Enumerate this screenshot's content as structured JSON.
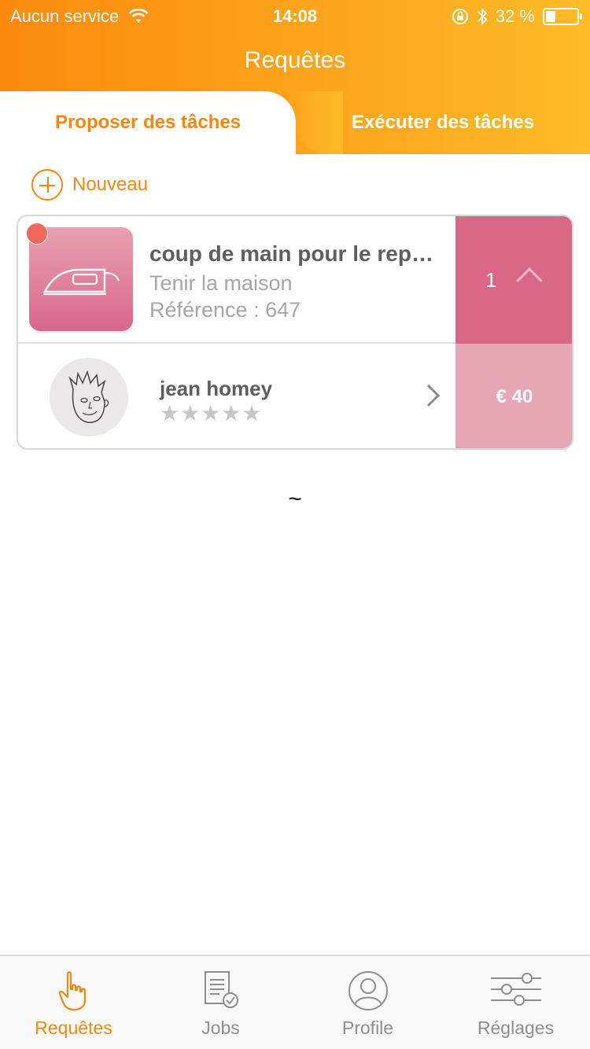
{
  "status_bar": {
    "carrier": "Aucun service",
    "time": "14:08",
    "battery_percent": "32 %",
    "battery_level": 0.32
  },
  "nav": {
    "title": "Requêtes"
  },
  "tabs": [
    {
      "label": "Proposer des tâches",
      "active": true
    },
    {
      "label": "Exécuter des tâches",
      "active": false
    }
  ],
  "new_button": {
    "label": "Nouveau"
  },
  "request_card": {
    "title": "coup de main pour le rep…",
    "category": "Tenir la maison",
    "reference": "Référence : 647",
    "count": "1",
    "user_name": "jean homey",
    "stars": "★★★★★",
    "rating": 0,
    "price": "€ 40",
    "icon": "iron-icon"
  },
  "footer_mark": "~",
  "tabbar": [
    {
      "label": "Requêtes",
      "icon": "hand-pointer-icon",
      "active": true
    },
    {
      "label": "Jobs",
      "icon": "document-check-icon",
      "active": false
    },
    {
      "label": "Profile",
      "icon": "user-icon",
      "active": false
    },
    {
      "label": "Réglages",
      "icon": "sliders-icon",
      "active": false
    }
  ],
  "colors": {
    "accent": "#f5870f",
    "task_pink": "#d96786",
    "price_pink": "#e6a7b5",
    "notification_red": "#f0685b"
  }
}
